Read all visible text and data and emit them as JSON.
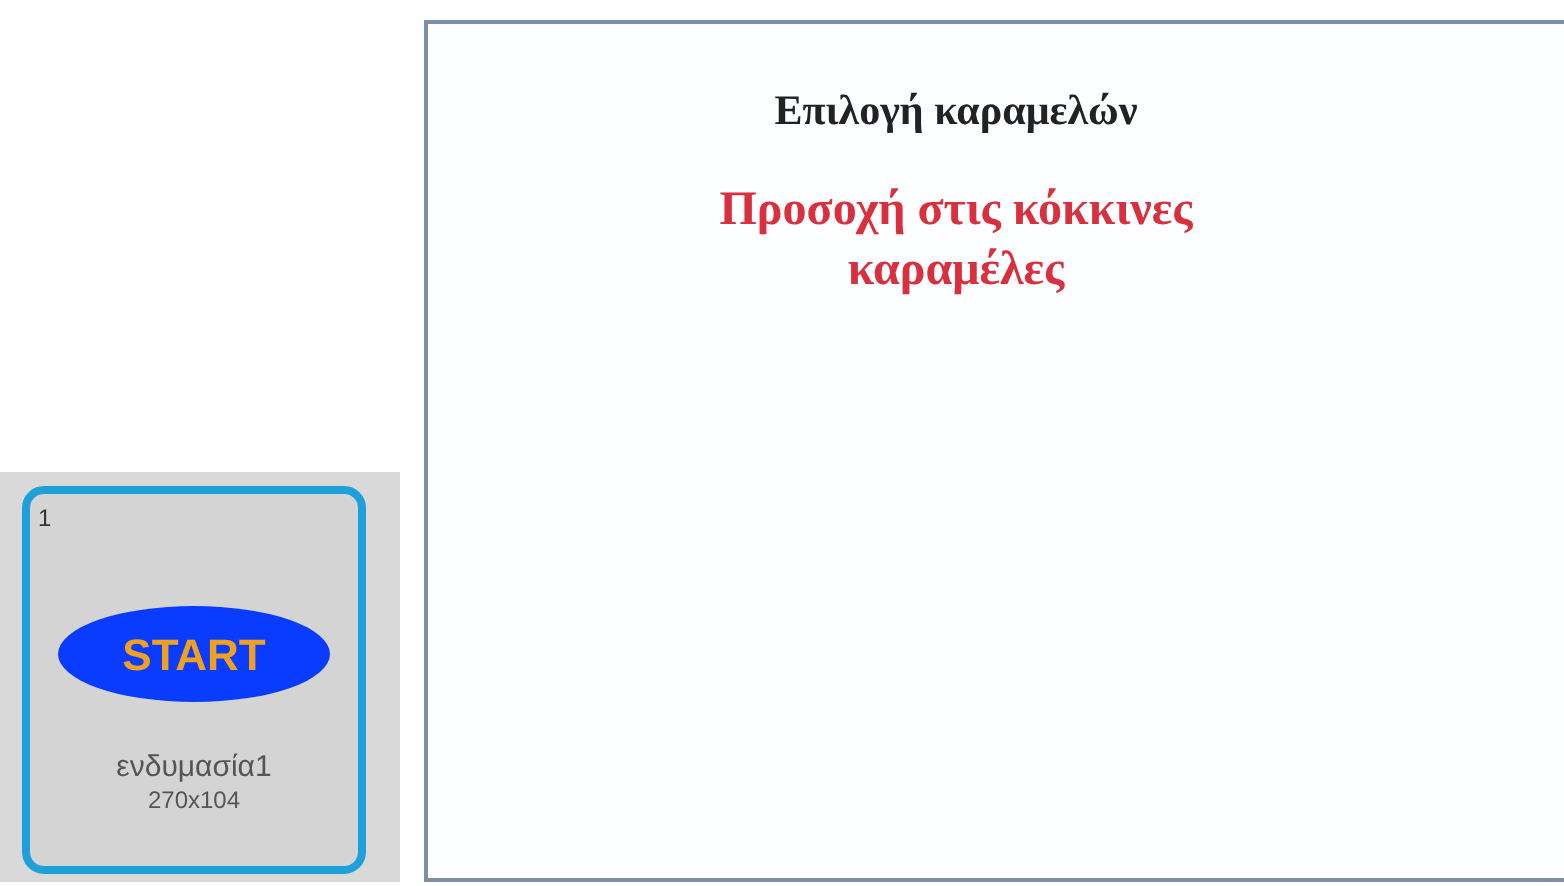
{
  "costumes": [
    {
      "number": "1",
      "image_label": "START",
      "name": "ενδυμασία1",
      "size": "270x104",
      "selected": true
    }
  ],
  "stage": {
    "title": "Επιλογή καραμελών",
    "warning": "Προσοχή στις κόκκινες καραμέλες"
  }
}
